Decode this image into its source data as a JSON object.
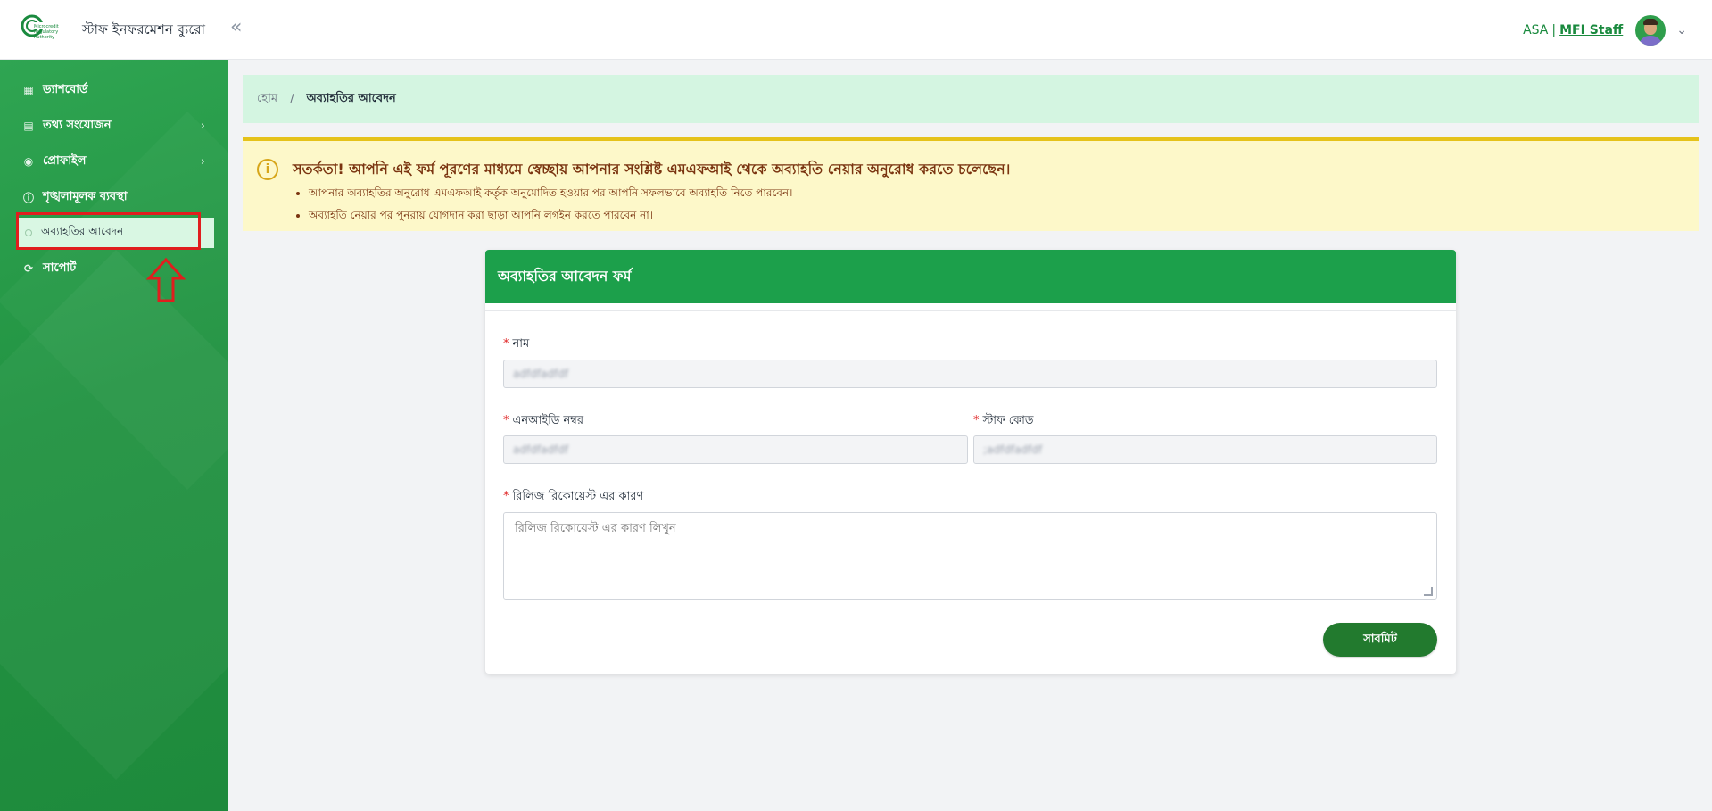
{
  "header": {
    "app_title": "স্টাফ ইনফরমেশন ব্যুরো",
    "collapse_icon": "double-chevron-left",
    "org_label": "ASA",
    "separator": "|",
    "role_label": "MFI Staff"
  },
  "sidebar": {
    "items": [
      {
        "label": "ড্যাশবোর্ড",
        "icon": "grid-icon",
        "has_children": false
      },
      {
        "label": "তথ্য সংযোজন",
        "icon": "document-icon",
        "has_children": true
      },
      {
        "label": "প্রোফাইল",
        "icon": "user-circle-icon",
        "has_children": true
      },
      {
        "label": "শৃঙ্খলামূলক ব্যবস্থা",
        "icon": "info-icon",
        "has_children": false
      },
      {
        "label": "সাপোর্ট",
        "icon": "refresh-icon",
        "has_children": false
      }
    ],
    "active_subitem": "অব্যাহতির আবেদন"
  },
  "breadcrumb": {
    "home": "হোম",
    "separator": "/",
    "current": "অব্যাহতির আবেদন"
  },
  "alert": {
    "title": "সতর্কতা! আপনি এই ফর্ম পূরণের মাধ্যমে স্বেচ্ছায় আপনার সংশ্লিষ্ট এমএফআই থেকে অব্যাহতি নেয়ার অনুরোধ করতে চলেছেন।",
    "points": [
      "আপনার অব্যাহতির অনুরোধ এমএফআই কর্তৃক অনুমোদিত হওয়ার পর আপনি সফলভাবে অব্যাহতি নিতে পারবেন।",
      "অব্যাহতি নেয়ার পর পুনরায় যোগদান করা ছাড়া আপনি লগইন করতে পারবেন না।"
    ]
  },
  "form": {
    "title": "অব্যাহতির আবেদন ফর্ম",
    "required_mark": "*",
    "name_label": "নাম",
    "name_value": "adfdfadfdf",
    "nid_label": "এনআইডি নম্বর",
    "nid_value": "adfdfadfdf",
    "staff_code_label": "স্টাফ কোড",
    "staff_code_value": ";adfdfadfdf",
    "reason_label": "রিলিজ রিকোয়েস্ট এর কারণ",
    "reason_placeholder": "রিলিজ রিকোয়েস্ট এর কারণ লিখুন",
    "submit_label": "সাবমিট"
  },
  "colors": {
    "primary_green": "#1ca04b",
    "sidebar_green": "#229342",
    "alert_bg": "#fdf8c9",
    "alert_border": "#e5c21a",
    "annotation_red": "#e01e1e"
  }
}
